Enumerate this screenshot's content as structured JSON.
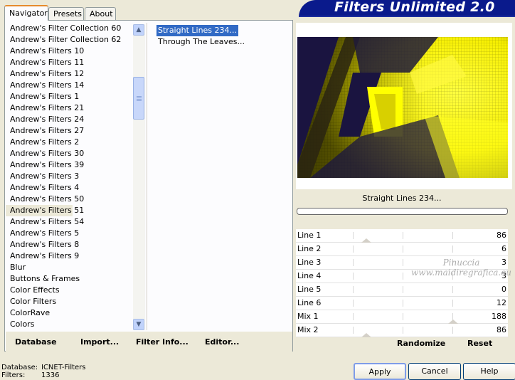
{
  "banner": {
    "title": "Filters Unlimited 2.0"
  },
  "tabs": [
    {
      "label": "Navigator"
    },
    {
      "label": "Presets"
    },
    {
      "label": "About"
    }
  ],
  "categories": {
    "items": [
      "Andrew's Filter Collection 60",
      "Andrew's Filter Collection 62",
      "Andrew's Filters 10",
      "Andrew's Filters 11",
      "Andrew's Filters 12",
      "Andrew's Filters 14",
      "Andrew's Filters 1",
      "Andrew's Filters 21",
      "Andrew's Filters 24",
      "Andrew's Filters 27",
      "Andrew's Filters 2",
      "Andrew's Filters 30",
      "Andrew's Filters 39",
      "Andrew's Filters 3",
      "Andrew's Filters 4",
      "Andrew's Filters 50",
      "Andrew's Filters 51",
      "Andrew's Filters 54",
      "Andrew's Filters 5",
      "Andrew's Filters 8",
      "Andrew's Filters 9",
      "Blur",
      "Buttons & Frames",
      "Color Effects",
      "Color Filters",
      "ColorRave",
      "Colors"
    ],
    "selected": "Andrew's Filters 51"
  },
  "filters": {
    "items": [
      "Straight Lines 234...",
      "Through The Leaves..."
    ],
    "selected": "Straight Lines 234..."
  },
  "left_buttons": {
    "database": "Database",
    "import": "Import...",
    "filter_info": "Filter Info...",
    "editor": "Editor..."
  },
  "preview": {
    "filter_name": "Straight Lines 234...",
    "progress": 0
  },
  "sliders": [
    {
      "label": "Line 1",
      "value": "86"
    },
    {
      "label": "Line 2",
      "value": "6"
    },
    {
      "label": "Line 3",
      "value": "3"
    },
    {
      "label": "Line 4",
      "value": "3"
    },
    {
      "label": "Line 5",
      "value": "0"
    },
    {
      "label": "Line 6",
      "value": "12"
    },
    {
      "label": "Mix 1",
      "value": "188"
    },
    {
      "label": "Mix 2",
      "value": "86"
    }
  ],
  "right_buttons": {
    "randomize": "Randomize",
    "reset": "Reset"
  },
  "watermark": {
    "line1": "Pinuccia",
    "line2": "www.maidiregrafica.eu"
  },
  "status": {
    "database_label": "Database:",
    "database_value": "ICNET-Filters",
    "filters_label": "Filters:",
    "filters_value": "1336"
  },
  "bottom_buttons": {
    "apply": "Apply",
    "cancel": "Cancel",
    "help": "Help"
  },
  "colors": {
    "selection": "#316ac5",
    "banner": "#0a1a8c",
    "preview_yellow": "#ffff00",
    "preview_dark": "#1a1440"
  }
}
